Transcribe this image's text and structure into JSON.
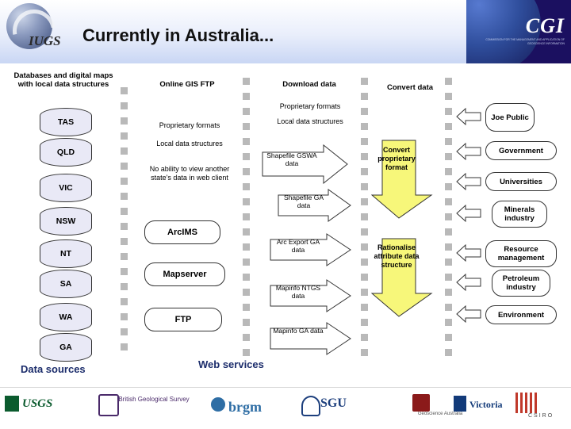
{
  "header": {
    "title": "Currently in Australia...",
    "cgi_title": "CGI",
    "cgi_sub": "COMMISSION FOR THE MANAGEMENT AND APPLICATION OF GEOSCIENCE INFORMATION",
    "iugs_label": "IUGS"
  },
  "columns": [
    {
      "name": "col1",
      "label": "Databases and digital maps with local data structures"
    },
    {
      "name": "col2",
      "label": "Online GIS FTP"
    },
    {
      "name": "col3",
      "label": "Download data"
    },
    {
      "name": "col4",
      "label": "Convert data"
    }
  ],
  "sections": {
    "data_sources": "Data sources",
    "web_services": "Web services"
  },
  "databases": [
    {
      "label": "TAS"
    },
    {
      "label": "QLD"
    },
    {
      "label": "VIC"
    },
    {
      "label": "NSW"
    },
    {
      "label": "NT"
    },
    {
      "label": "SA"
    },
    {
      "label": "WA"
    },
    {
      "label": "GA"
    }
  ],
  "services": {
    "notes": [
      "Proprietary formats",
      "Local data structures",
      "No ability to view another state's data in web client"
    ],
    "boxes": [
      {
        "label": "ArcIMS"
      },
      {
        "label": "Mapserver"
      },
      {
        "label": "FTP"
      }
    ]
  },
  "download": {
    "notes": [
      "Proprietary formats",
      "Local data structures"
    ],
    "arrows": [
      {
        "label": "Shapefile GSWA data"
      },
      {
        "label": "Shapefile GA data"
      },
      {
        "label": "Arc Export GA data"
      },
      {
        "label": "Mapinfo NTGS data"
      },
      {
        "label": "Mapinfo GA data"
      }
    ]
  },
  "convert": {
    "steps": [
      {
        "label": "Convert proprietary format"
      },
      {
        "label": "Rationalise attribute data structure"
      }
    ]
  },
  "consumers": [
    {
      "label": "Joe Public"
    },
    {
      "label": "Government"
    },
    {
      "label": "Universities"
    },
    {
      "label": "Minerals industry"
    },
    {
      "label": "Resource management"
    },
    {
      "label": "Petroleum industry"
    },
    {
      "label": "Environment"
    }
  ],
  "footer_logos": [
    {
      "label": "USGS"
    },
    {
      "label": "British Geological Survey"
    },
    {
      "label": "brgm"
    },
    {
      "label": "SGU"
    },
    {
      "label": "Geoscience Australia"
    },
    {
      "label": "Victoria"
    },
    {
      "label": "CSIRO"
    }
  ],
  "colors": {
    "header_band": "#c9d6f4",
    "cgi_navy": "#1b1060",
    "section_heading": "#1b2c6b",
    "box_fill": "#ffffff",
    "cyl_fill": "#e9e9f6",
    "dot_grey": "#b9b9b9"
  }
}
